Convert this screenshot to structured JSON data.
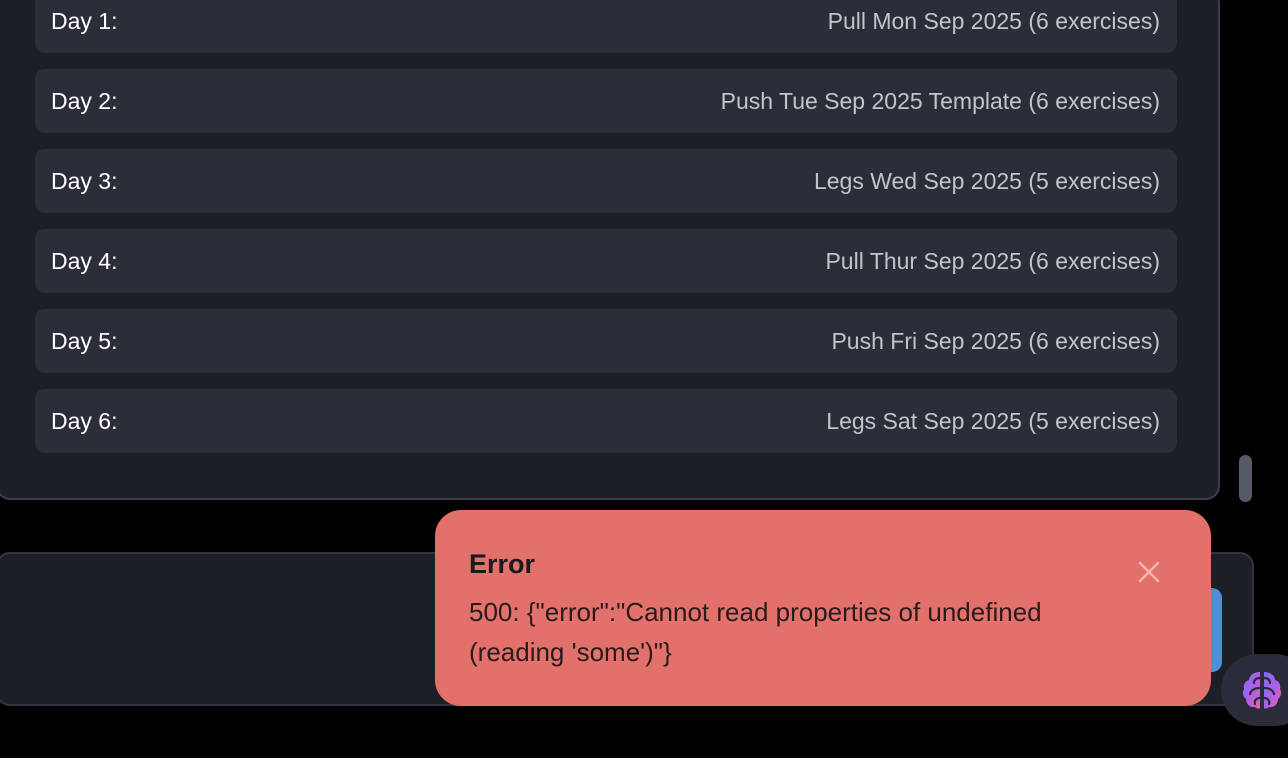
{
  "schedule": {
    "days": [
      {
        "label": "Day 1:",
        "value": "Pull Mon Sep 2025 (6 exercises)"
      },
      {
        "label": "Day 2:",
        "value": "Push Tue Sep 2025 Template (6 exercises)"
      },
      {
        "label": "Day 3:",
        "value": "Legs Wed Sep 2025 (5 exercises)"
      },
      {
        "label": "Day 4:",
        "value": "Pull Thur Sep 2025 (6 exercises)"
      },
      {
        "label": "Day 5:",
        "value": "Push Fri Sep 2025 (6 exercises)"
      },
      {
        "label": "Day 6:",
        "value": "Legs Sat Sep 2025 (5 exercises)"
      }
    ]
  },
  "toast": {
    "title": "Error",
    "message": "500: {\"error\":\"Cannot read properties of undefined (reading 'some')\"}",
    "close_icon": "close-icon",
    "background_color": "#e2706b"
  },
  "assistant": {
    "icon": "brain-icon"
  },
  "colors": {
    "panel_bg": "#1c1f26",
    "row_bg": "#2b2e39",
    "accent_blue": "#4f8fd6"
  }
}
